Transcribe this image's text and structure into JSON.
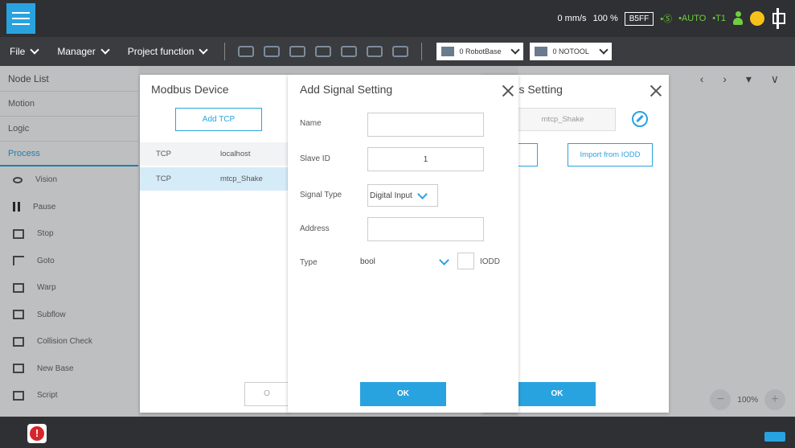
{
  "topbar": {
    "speed": "0 mm/s",
    "percent": "100 %",
    "badge": "B5FF",
    "mode1": "•Ⓢ",
    "mode2": "•AUTO",
    "mode3": "•T1"
  },
  "menubar": {
    "file": "File",
    "manager": "Manager",
    "project": "Project function",
    "base_select": "0 RobotBase",
    "tool_select": "0 NOTOOL"
  },
  "sidebar": {
    "title": "Node List",
    "motion": "Motion",
    "logic": "Logic",
    "process": "Process",
    "items": [
      "Vision",
      "Pause",
      "Stop",
      "Goto",
      "Warp",
      "Subflow",
      "Collision Check",
      "New Base",
      "Script"
    ]
  },
  "canvas": {
    "zoom": "100%"
  },
  "modbus": {
    "title": "Modbus Device",
    "add_tcp": "Add TCP",
    "rows": [
      {
        "type": "TCP",
        "name": "localhost"
      },
      {
        "type": "TCP",
        "name": "mtcp_Shake"
      }
    ],
    "partial_button": "O"
  },
  "device_setting": {
    "title": "ce's Setting",
    "name": "mtcp_Shake",
    "import_iodd": "Import from IODD",
    "ok": "OK"
  },
  "signal": {
    "title": "Add Signal Setting",
    "name_label": "Name",
    "name_value": "",
    "slave_label": "Slave ID",
    "slave_value": "1",
    "type_label": "Signal Type",
    "type_value": "Digital Input",
    "address_label": "Address",
    "address_value": "",
    "dtype_label": "Type",
    "dtype_value": "bool",
    "iodd_label": "IODD",
    "ok": "OK"
  }
}
